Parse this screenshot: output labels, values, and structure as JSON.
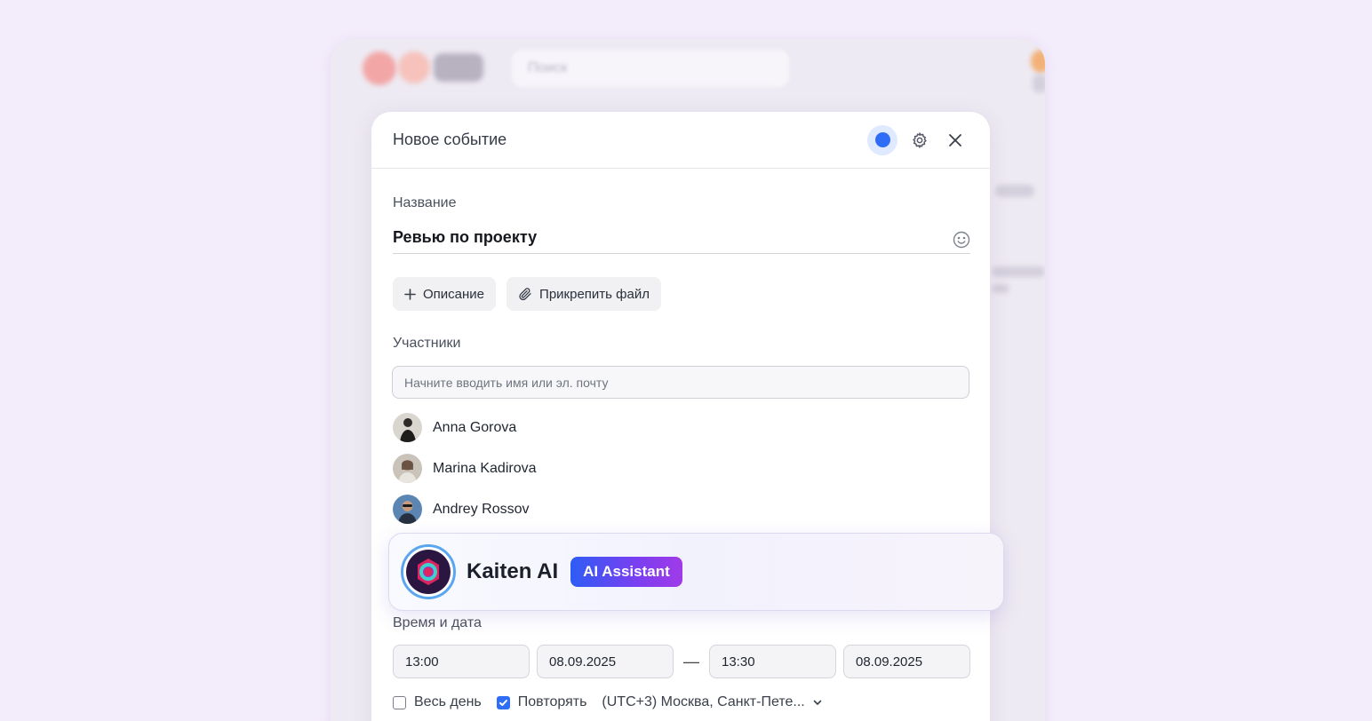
{
  "background_app": {
    "search_placeholder": "Поиск"
  },
  "modal": {
    "title": "Новое событие",
    "event_color": "#2f6df6",
    "icons": {
      "settings": "gear-icon",
      "close": "close-icon"
    }
  },
  "name_section": {
    "label": "Название",
    "value": "Ревью по проекту",
    "emoji_icon": "smile-icon"
  },
  "actions": {
    "description_label": "Описание",
    "attach_label": "Прикрепить файл"
  },
  "participants": {
    "label": "Участники",
    "search_placeholder": "Начните вводить имя или эл. почту",
    "people": [
      {
        "name": "Anna Gorova"
      },
      {
        "name": "Marina Kadirova"
      },
      {
        "name": "Andrey Rossov"
      }
    ]
  },
  "ai_card": {
    "name": "Kaiten AI",
    "badge": "AI Assistant"
  },
  "datetime": {
    "label": "Время и дата",
    "start_time": "13:00",
    "start_date": "08.09.2025",
    "separator": "—",
    "end_time": "13:30",
    "end_date": "08.09.2025"
  },
  "options": {
    "all_day_label": "Весь день",
    "all_day_checked": false,
    "repeat_label": "Повторять",
    "repeat_checked": true,
    "timezone": "(UTC+3) Москва, Санкт-Пете..."
  }
}
